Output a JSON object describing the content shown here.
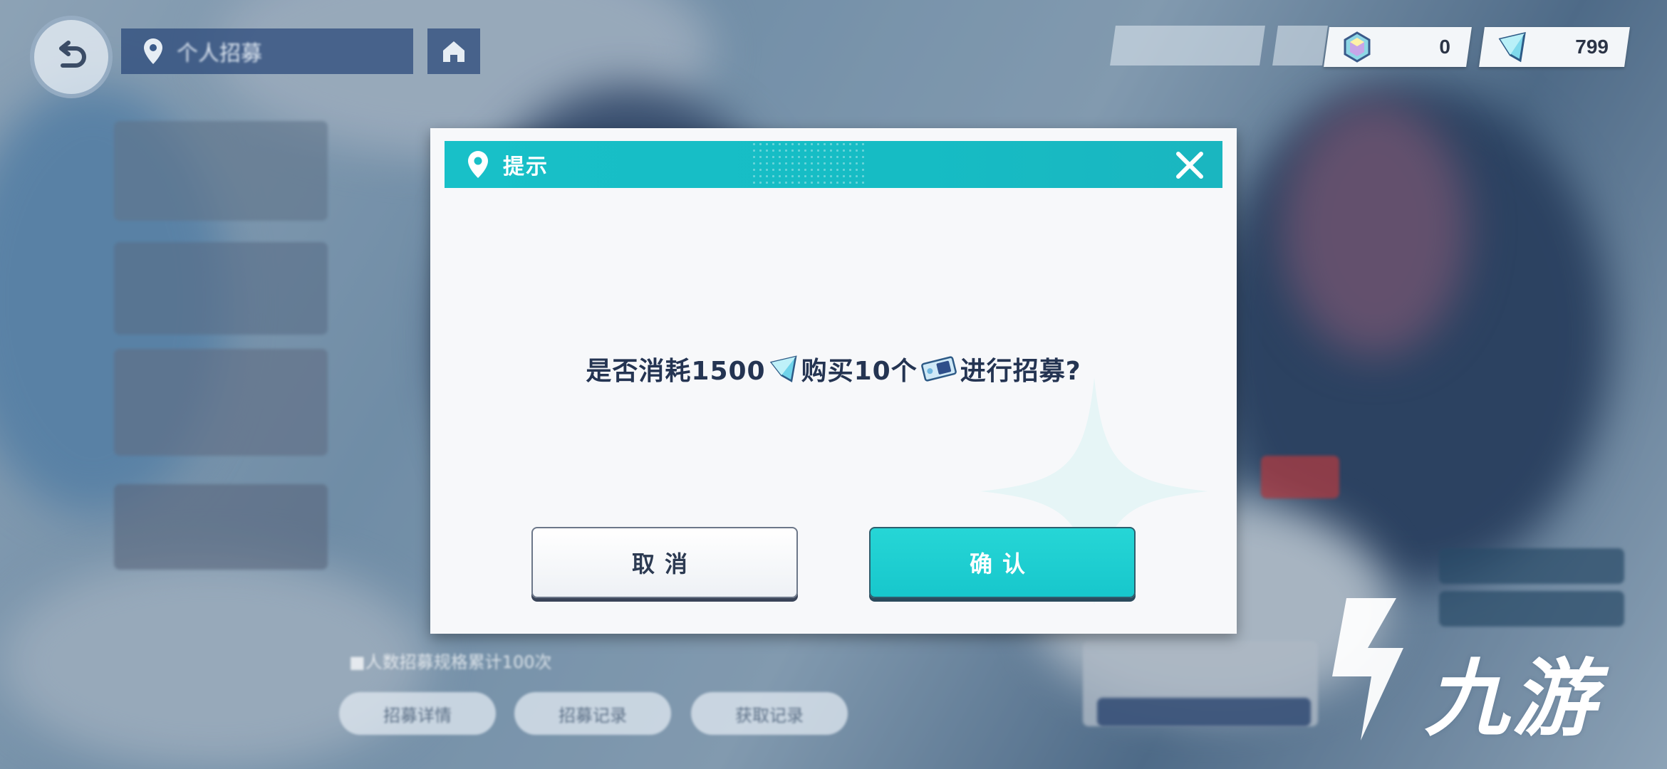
{
  "top_bar": {
    "nav_title": "个人招募",
    "currencies": [
      {
        "icon": "rainbow-crystal-icon",
        "value": "0"
      },
      {
        "icon": "blue-ticket-crystal-icon",
        "value": "799"
      }
    ]
  },
  "background": {
    "caption": "■人数招募规格累计100次",
    "buttons": [
      "招募详情",
      "招募记录",
      "获取记录"
    ]
  },
  "dialog": {
    "title": "提示",
    "message_parts": [
      "是否消耗1500",
      "购买10个",
      "进行招募?"
    ],
    "message_icons": [
      "blue-crystal-icon",
      "recruit-ticket-icon"
    ],
    "cancel_label": "取消",
    "confirm_label": "确认"
  },
  "watermark": {
    "text": "九游"
  },
  "colors": {
    "header": "#18c0c8",
    "confirm": "#1fcfd2",
    "text_dark": "#243452"
  }
}
